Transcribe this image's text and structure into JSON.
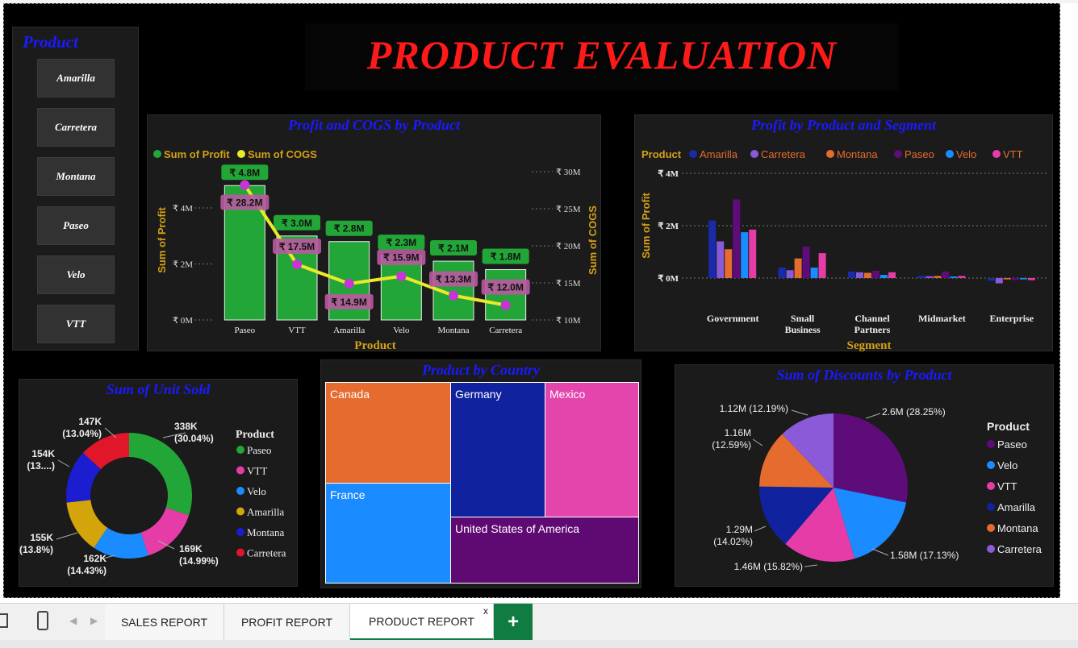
{
  "banner": {
    "title": "PRODUCT EVALUATION",
    "title_color": "#ff1a1a"
  },
  "slicer": {
    "title": "Product",
    "items": [
      "Amarilla",
      "Carretera",
      "Montana",
      "Paseo",
      "Velo",
      "VTT"
    ]
  },
  "profit_cogs": {
    "title": "Profit and COGS by Product",
    "legend": [
      "Sum of Profit",
      "Sum of COGS"
    ],
    "xlabel": "Product",
    "ylabel_left": "Sum of Profit",
    "ylabel_right": "Sum of COGS",
    "left_ticks": [
      "₹ 0M",
      "₹ 2M",
      "₹ 4M"
    ],
    "right_ticks": [
      "₹ 10M",
      "₹ 15M",
      "₹ 20M",
      "₹ 25M",
      "₹ 30M"
    ]
  },
  "segment": {
    "title": "Profit by Product and Segment",
    "legend_title": "Product",
    "xlabel": "Segment",
    "ylabel": "Sum of Profit",
    "ticks": [
      "₹ 0M",
      "₹ 2M",
      "₹ 4M"
    ]
  },
  "units": {
    "title": "Sum of Unit Sold",
    "legend_title": "Product",
    "labels": [
      "338K\n(30.04%)",
      "169K\n(14.99%)",
      "162K\n(14.43%)",
      "155K\n(13.8%)",
      "154K\n(13....)",
      "147K\n(13.04%)"
    ]
  },
  "country": {
    "title": "Product by Country",
    "cells": [
      "Canada",
      "Germany",
      "Mexico",
      "France",
      "United States of America"
    ]
  },
  "discounts": {
    "title": "Sum of Discounts by Product",
    "legend_title": "Product",
    "labels": [
      "2.6M (28.25%)",
      "1.58M (17.13%)",
      "1.46M (15.82%)",
      "1.29M\n(14.02%)",
      "1.16M\n(12.59%)",
      "1.12M (12.19%)"
    ]
  },
  "tabs": [
    "SALES REPORT",
    "PROFIT REPORT",
    "PRODUCT REPORT"
  ],
  "tab_close": "x",
  "tab_add": "+",
  "colors": {
    "panel_title": "#1a1aff",
    "bar_green": "#22a637",
    "line_yellow": "#e8ea2a",
    "marker_magenta": "#c933d6",
    "label_gold": "#d4a017"
  },
  "chart_data": [
    {
      "type": "bar",
      "title": "Profit and COGS by Product",
      "categories": [
        "Paseo",
        "VTT",
        "Amarilla",
        "Velo",
        "Montana",
        "Carretera"
      ],
      "series": [
        {
          "name": "Sum of Profit",
          "values": [
            4.8,
            3.0,
            2.8,
            2.3,
            2.1,
            1.8
          ],
          "labels": [
            "₹ 4.8M",
            "₹ 3.0M",
            "₹ 2.8M",
            "₹ 2.3M",
            "₹ 2.1M",
            "₹ 1.8M"
          ]
        },
        {
          "name": "Sum of COGS",
          "type": "line",
          "values": [
            28.2,
            17.5,
            14.9,
            15.9,
            13.3,
            12.0
          ],
          "labels": [
            "₹ 28.2M",
            "₹ 17.5M",
            "₹ 14.9M",
            "₹ 15.9M",
            "₹ 13.3M",
            "₹ 12.0M"
          ]
        }
      ],
      "xlabel": "Product",
      "ylabel": "Sum of Profit",
      "y2label": "Sum of COGS",
      "ylim": [
        0,
        5.7
      ],
      "y2lim": [
        10,
        30
      ],
      "legend": "top-left"
    },
    {
      "type": "bar",
      "title": "Profit by Product and Segment",
      "categories": [
        "Government",
        "Small Business",
        "Channel Partners",
        "Midmarket",
        "Enterprise"
      ],
      "series": [
        {
          "name": "Amarilla",
          "color": "#1a2aa8",
          "values": [
            2.2,
            0.4,
            0.25,
            0.08,
            -0.1
          ]
        },
        {
          "name": "Carretera",
          "color": "#8a5ad8",
          "values": [
            1.4,
            0.3,
            0.22,
            0.07,
            -0.2
          ]
        },
        {
          "name": "Montana",
          "color": "#e56b2e",
          "values": [
            1.1,
            0.75,
            0.2,
            0.08,
            -0.05
          ]
        },
        {
          "name": "Paseo",
          "color": "#5e0c7a",
          "values": [
            3.0,
            1.2,
            0.28,
            0.25,
            -0.08
          ]
        },
        {
          "name": "Velo",
          "color": "#1a8cff",
          "values": [
            1.75,
            0.4,
            0.12,
            0.06,
            -0.05
          ]
        },
        {
          "name": "VTT",
          "color": "#e63ca8",
          "values": [
            1.85,
            0.95,
            0.22,
            0.08,
            -0.08
          ]
        }
      ],
      "xlabel": "Segment",
      "ylabel": "Sum of Profit",
      "ylim": [
        -0.5,
        4
      ],
      "legend": "top"
    },
    {
      "type": "pie",
      "title": "Sum of Unit Sold",
      "donut": true,
      "categories": [
        "Paseo",
        "VTT",
        "Velo",
        "Amarilla",
        "Montana",
        "Carretera"
      ],
      "colors": [
        "#22a637",
        "#e63ca8",
        "#1a8cff",
        "#d4a50a",
        "#1c1cd1",
        "#e0162b"
      ],
      "values": [
        338,
        169,
        162,
        155,
        154,
        147
      ],
      "percents": [
        30.04,
        14.99,
        14.43,
        13.8,
        13.7,
        13.04
      ],
      "legend": "right"
    },
    {
      "type": "table",
      "title": "Product by Country",
      "categories": [
        "Canada",
        "Germany",
        "Mexico",
        "France",
        "United States of America"
      ],
      "colors": [
        "#e56b2e",
        "#10229e",
        "#e345ad",
        "#1a8cff",
        "#5f0a73"
      ]
    },
    {
      "type": "pie",
      "title": "Sum of Discounts by Product",
      "categories": [
        "Paseo",
        "Velo",
        "VTT",
        "Amarilla",
        "Montana",
        "Carretera"
      ],
      "colors": [
        "#5e0c7a",
        "#1a8cff",
        "#e63ca8",
        "#10229e",
        "#e56b2e",
        "#8a5ad8"
      ],
      "values": [
        2.6,
        1.58,
        1.46,
        1.29,
        1.16,
        1.12
      ],
      "percents": [
        28.25,
        17.13,
        15.82,
        14.02,
        12.59,
        12.19
      ],
      "legend": "right"
    }
  ]
}
